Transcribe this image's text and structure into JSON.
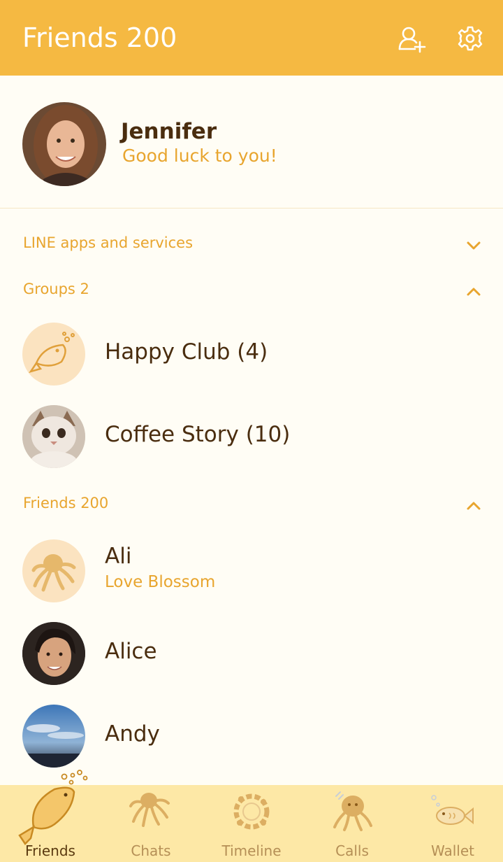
{
  "header": {
    "title": "Friends 200",
    "add_friend_icon": "add-friend-icon",
    "settings_icon": "gear-icon"
  },
  "profile": {
    "name": "Jennifer",
    "status": "Good luck to you!"
  },
  "sections": {
    "services": {
      "label": "LINE apps and services",
      "state": "collapsed"
    },
    "groups": {
      "label": "Groups 2",
      "state": "expanded"
    },
    "friends": {
      "label": "Friends 200",
      "state": "expanded"
    }
  },
  "groups": [
    {
      "name": "Happy Club (4)"
    },
    {
      "name": "Coffee Story (10)"
    }
  ],
  "friends": [
    {
      "name": "Ali",
      "status": "Love Blossom"
    },
    {
      "name": "Alice"
    },
    {
      "name": "Andy"
    }
  ],
  "tabs": [
    {
      "label": "Friends",
      "icon": "fish-icon",
      "active": true
    },
    {
      "label": "Chats",
      "icon": "octopus-icon",
      "active": false
    },
    {
      "label": "Timeline",
      "icon": "flower-wreath-icon",
      "active": false
    },
    {
      "label": "Calls",
      "icon": "octopus-icon",
      "active": false
    },
    {
      "label": "Wallet",
      "icon": "fish-icon",
      "active": false
    }
  ],
  "colors": {
    "header": "#f5b942",
    "accent": "#e8a52e",
    "text": "#4a2d0f",
    "tabbar": "#fde8a6",
    "background": "#fffdf5"
  }
}
